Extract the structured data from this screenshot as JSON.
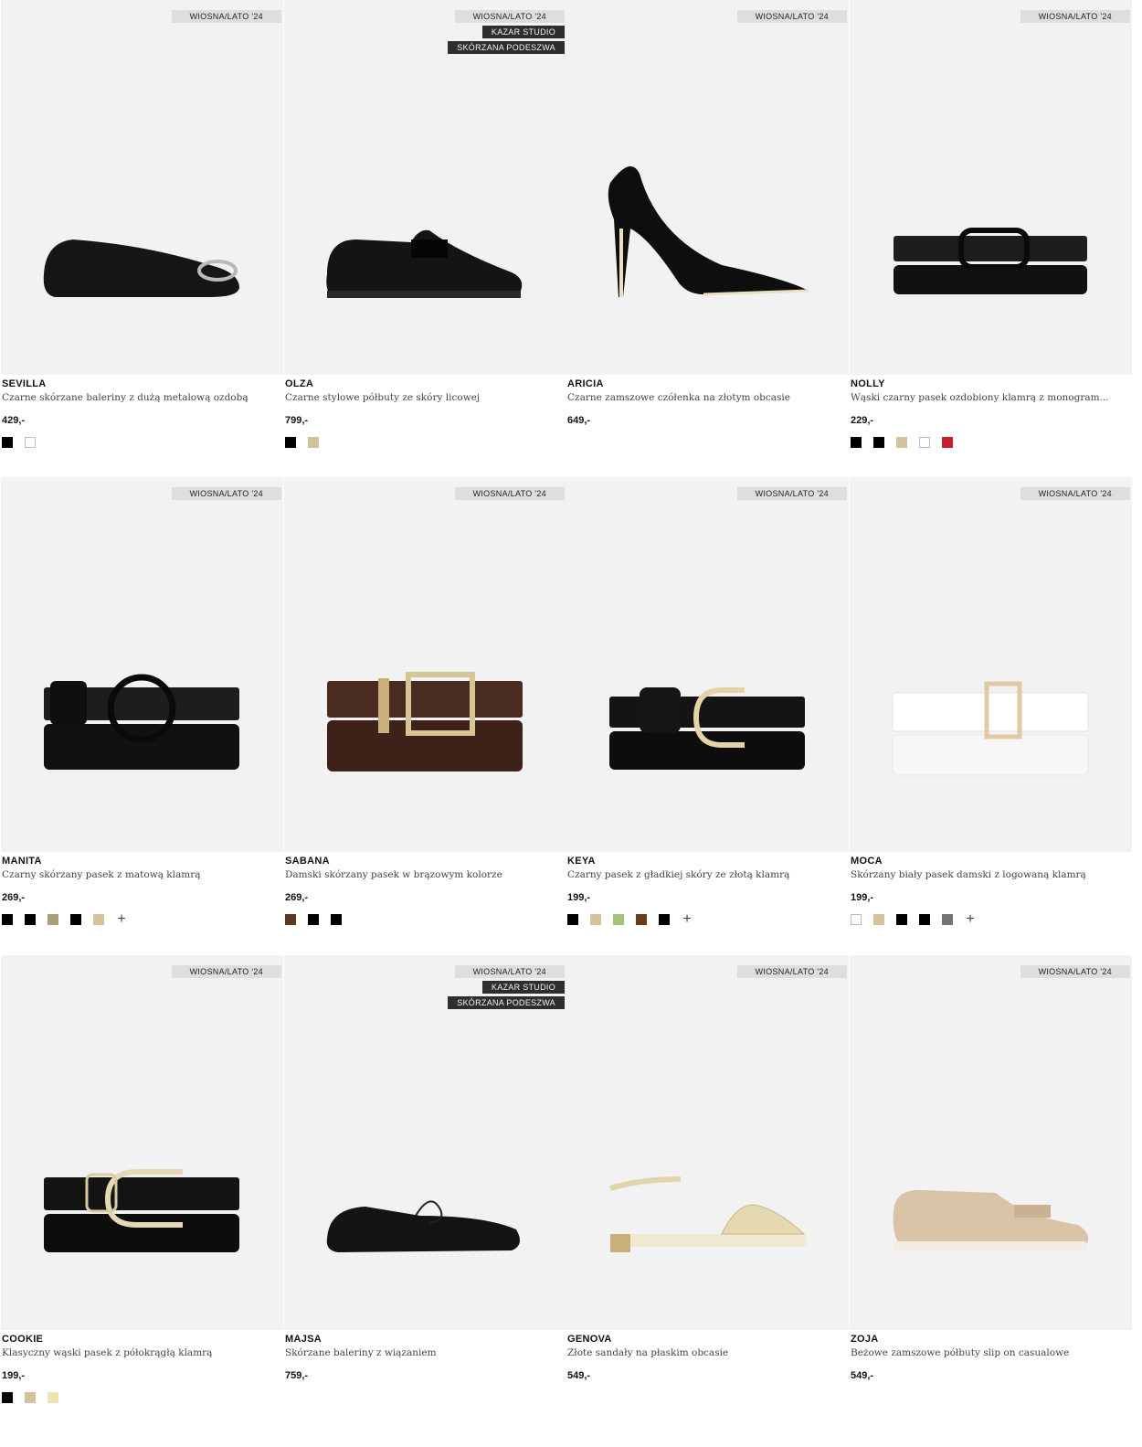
{
  "products": [
    {
      "name": "SEVILLA",
      "desc": "Czarne skórzane baleriny z dużą metalową ozdobą",
      "price": "429,-",
      "tags": [
        "WIOSNA/LATO '24"
      ],
      "image": "ballerina-black-icon",
      "swatches": [
        "#000000",
        "#ffffff"
      ],
      "more": false
    },
    {
      "name": "OLZA",
      "desc": "Czarne stylowe półbuty ze skóry licowej",
      "price": "799,-",
      "tags": [
        "WIOSNA/LATO '24",
        "KAZAR STUDIO",
        "SKÓRZANA PODESZWA"
      ],
      "image": "loafer-black-icon",
      "swatches": [
        "#000000",
        "#d6c29a"
      ],
      "more": false
    },
    {
      "name": "ARICIA",
      "desc": "Czarne zamszowe czółenka na złotym obcasie",
      "price": "649,-",
      "tags": [
        "WIOSNA/LATO '24"
      ],
      "image": "pump-black-icon",
      "swatches": [],
      "more": false
    },
    {
      "name": "NOLLY",
      "desc": "Wąski czarny pasek ozdobiony klamrą z monogram...",
      "price": "229,-",
      "tags": [
        "WIOSNA/LATO '24"
      ],
      "image": "belt-black-monogram-icon",
      "swatches": [
        "#000000",
        "#000000",
        "#d6c29a",
        "#ffffff",
        "#c8202b"
      ],
      "more": false
    },
    {
      "name": "MANITA",
      "desc": "Czarny skórzany pasek z matową klamrą",
      "price": "269,-",
      "tags": [
        "WIOSNA/LATO '24"
      ],
      "image": "belt-black-matte-icon",
      "swatches": [
        "#000000",
        "#000000",
        "#a99d7c",
        "#000000",
        "#d6c29a"
      ],
      "more": true
    },
    {
      "name": "SABANA",
      "desc": "Damski skórzany pasek w brązowym kolorze",
      "price": "269,-",
      "tags": [
        "WIOSNA/LATO '24"
      ],
      "image": "belt-brown-icon",
      "swatches": [
        "#5a3a22",
        "#000000",
        "#000000"
      ],
      "more": false
    },
    {
      "name": "KEYA",
      "desc": "Czarny pasek z gładkiej skóry ze złotą klamrą",
      "price": "199,-",
      "tags": [
        "WIOSNA/LATO '24"
      ],
      "image": "belt-black-gold-icon",
      "swatches": [
        "#000000",
        "#d6c29a",
        "#a7c07a",
        "#6b3c1c",
        "#000000"
      ],
      "more": true
    },
    {
      "name": "MOCA",
      "desc": "Skórzany biały pasek damski z logowaną klamrą",
      "price": "199,-",
      "tags": [
        "WIOSNA/LATO '24"
      ],
      "image": "belt-white-icon",
      "swatches": [
        "#ffffff",
        "#d6c29a",
        "#000000",
        "#000000",
        "#7a7470"
      ],
      "more": true
    },
    {
      "name": "COOKIE",
      "desc": "Klasyczny wąski pasek z półokrągłą klamrą",
      "price": "199,-",
      "tags": [
        "WIOSNA/LATO '24"
      ],
      "image": "belt-black-halfround-icon",
      "swatches": [
        "#000000",
        "#d6c29a",
        "#efe3b0"
      ],
      "more": false
    },
    {
      "name": "MAJSA",
      "desc": "Skórzane baleriny z wiązaniem",
      "price": "759,-",
      "tags": [
        "WIOSNA/LATO '24",
        "KAZAR STUDIO",
        "SKÓRZANA PODESZWA"
      ],
      "image": "ballerina-tie-icon",
      "swatches": [],
      "more": false
    },
    {
      "name": "GENOVA",
      "desc": "Złote sandały na płaskim obcasie",
      "price": "549,-",
      "tags": [
        "WIOSNA/LATO '24"
      ],
      "image": "sandal-gold-icon",
      "swatches": [],
      "more": false
    },
    {
      "name": "ZOJA",
      "desc": "Beżowe zamszowe półbuty slip on casualowe",
      "price": "549,-",
      "tags": [
        "WIOSNA/LATO '24"
      ],
      "image": "loafer-beige-icon",
      "swatches": [],
      "more": false
    }
  ]
}
